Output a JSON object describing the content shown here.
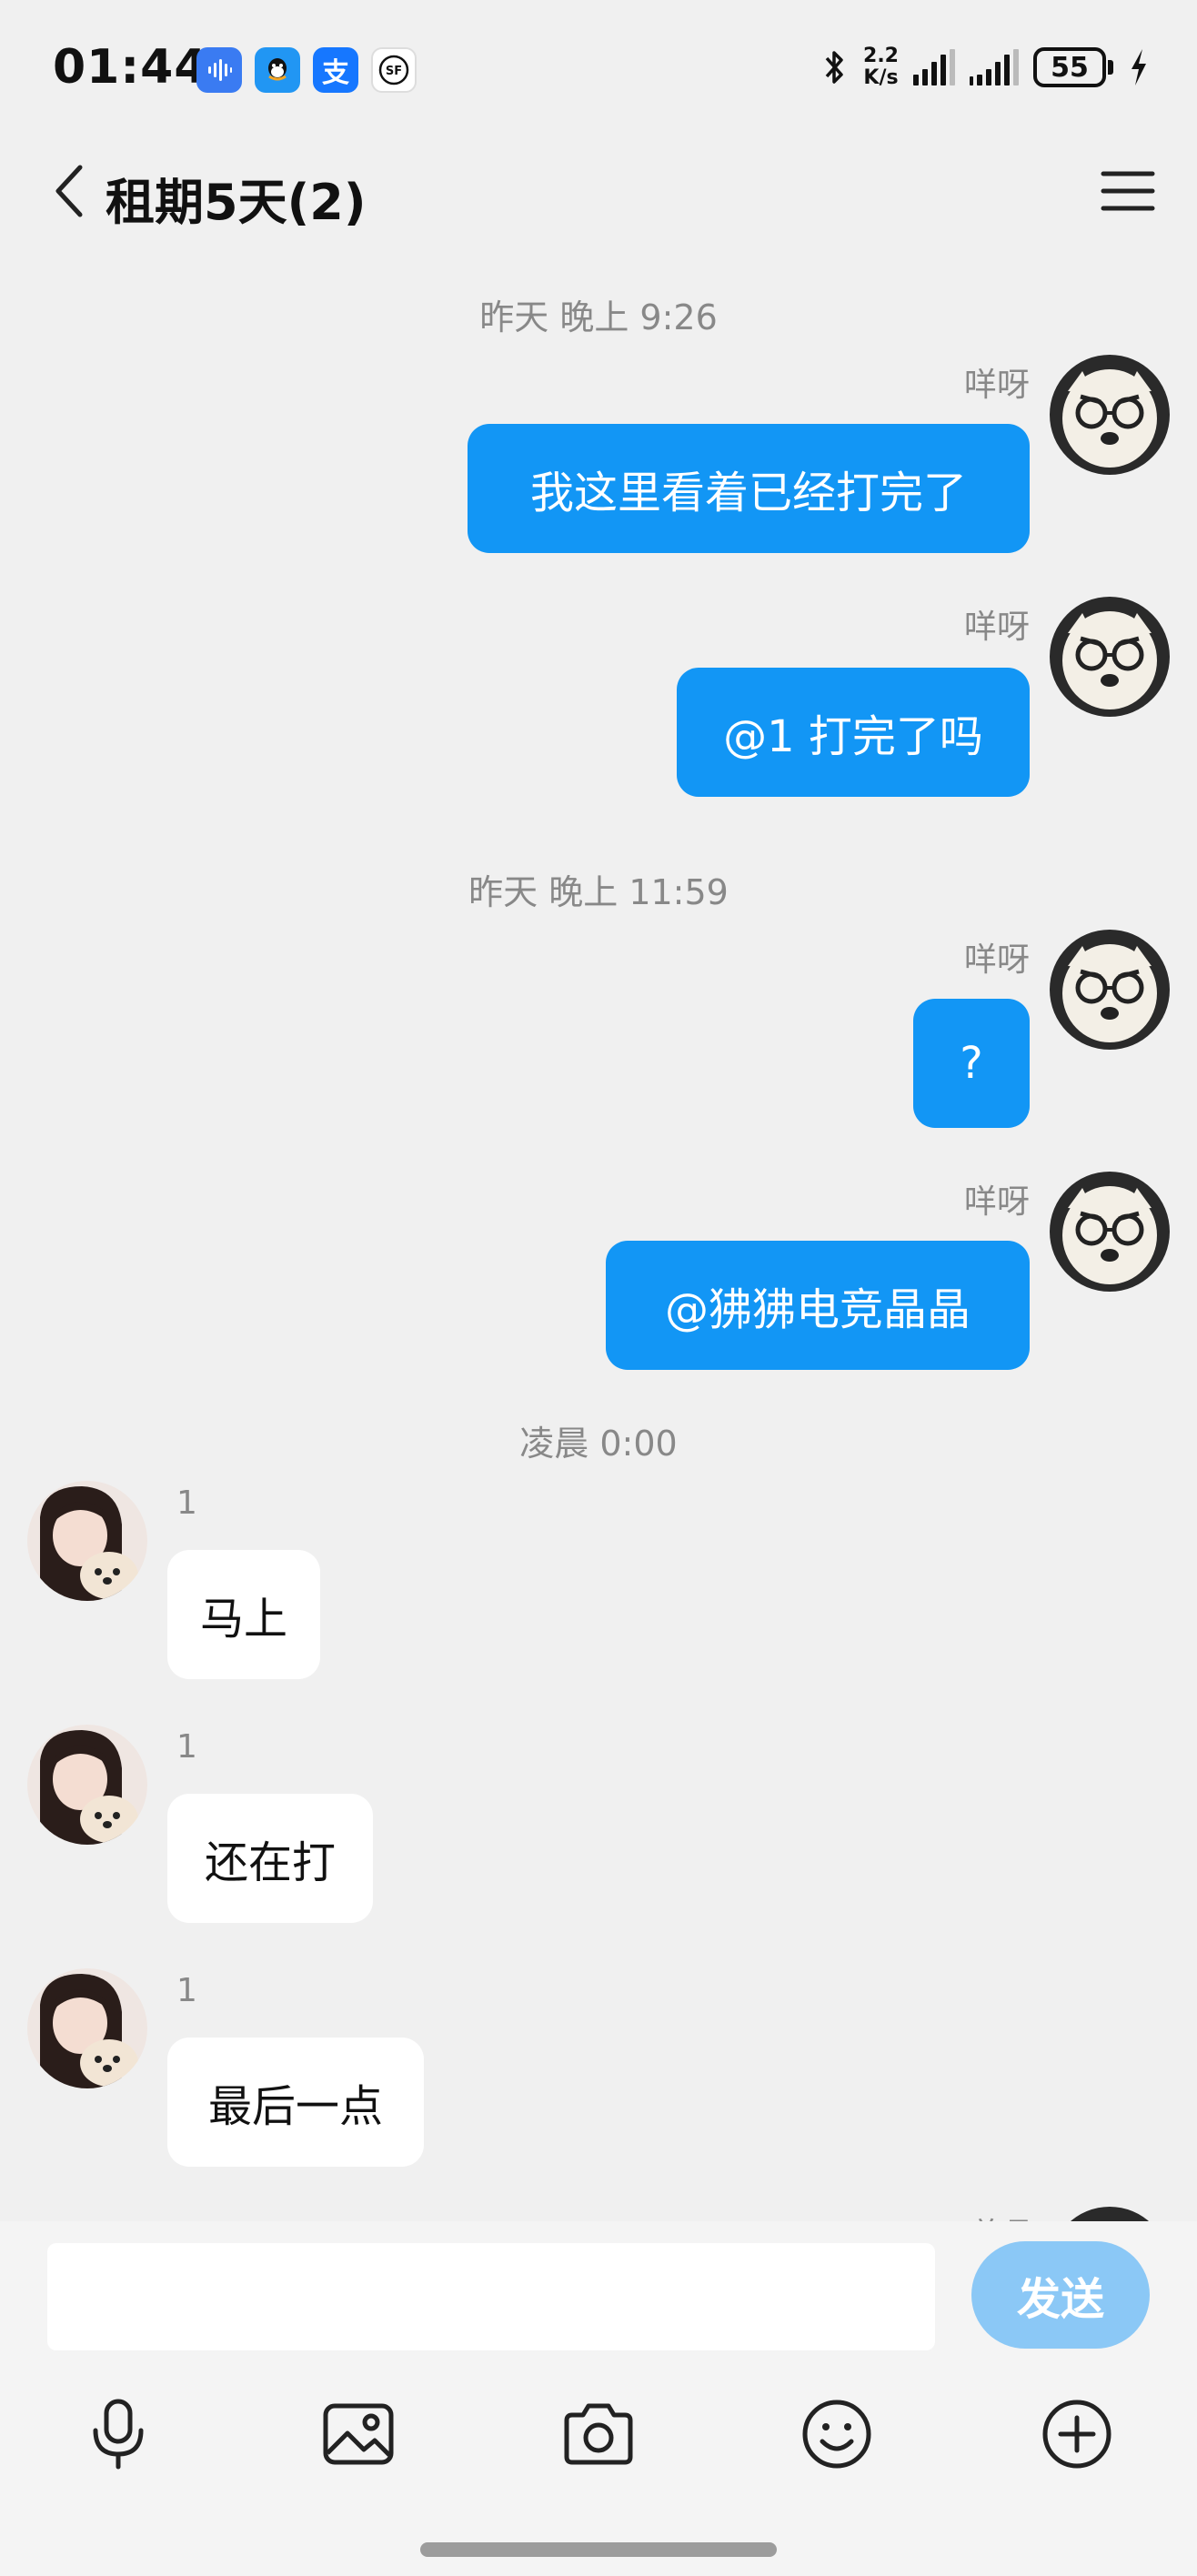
{
  "status_bar": {
    "time": "01:44",
    "net_speed_value": "2.2",
    "net_speed_unit": "K/s",
    "battery_level": "55",
    "app_icons": [
      "voice-assistant-icon",
      "qq-icon",
      "alipay-icon",
      "sf-express-icon"
    ],
    "alipay_glyph": "支",
    "sf_glyph": "SF"
  },
  "header": {
    "title": "租期5天(2)"
  },
  "messages": {
    "time_1": "昨天 晚上 9:26",
    "time_2": "昨天 晚上 11:59",
    "time_3": "凌晨 0:00",
    "out_sender": "咩呀",
    "in_sender": "1",
    "out_1": "我这里看着已经打完了",
    "out_2": "@1 打完了吗",
    "out_3": "?",
    "out_4": "@狒狒电竞晶晶",
    "in_1": "马上",
    "in_2": "还在打",
    "in_3": "最后一点",
    "partial_sender": "咩呀"
  },
  "input": {
    "value": "",
    "send_label": "发送"
  },
  "toolbar": {
    "items": [
      "microphone-icon",
      "image-icon",
      "camera-icon",
      "emoji-icon",
      "plus-icon"
    ]
  },
  "colors": {
    "outgoing_bubble": "#1296f5",
    "incoming_bubble": "#ffffff",
    "send_button": "#8bc8f6",
    "background": "#f0f0f0"
  }
}
